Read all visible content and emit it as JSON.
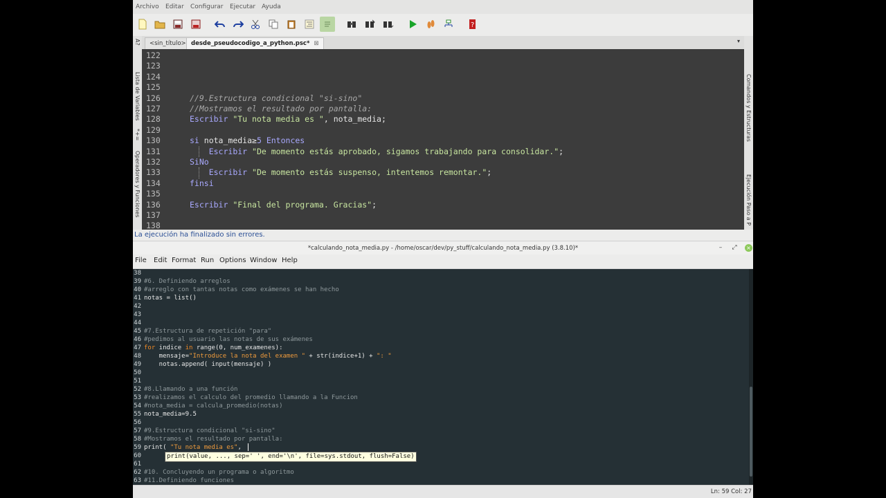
{
  "pseint": {
    "menu": [
      "Archivo",
      "Editar",
      "Configurar",
      "Ejecutar",
      "Ayuda"
    ],
    "left_panel_labels": [
      "Lista de Variables",
      "Operadores y Funciones"
    ],
    "left_panel_symbols": [
      "A?",
      "*+="
    ],
    "right_panel_labels": [
      "Comandos y Estructuras",
      "Ejecución Paso a P"
    ],
    "tabs": [
      {
        "label": "<sin_título>",
        "active": false
      },
      {
        "label": "desde_pseudocodigo_a_python.psc*",
        "active": true
      }
    ],
    "tab_close": "⊠",
    "tab_menu_arrow": "▾",
    "code_lines": [
      {
        "n": "122",
        "segs": []
      },
      {
        "n": "123",
        "segs": []
      },
      {
        "n": "124",
        "segs": []
      },
      {
        "n": "125",
        "segs": []
      },
      {
        "n": "126",
        "segs": [
          {
            "t": "//9.Estructura condicional \"si-sino\"",
            "c": "cmt"
          }
        ]
      },
      {
        "n": "127",
        "segs": [
          {
            "t": "//Mostramos el resultado por pantalla:",
            "c": "cmt"
          }
        ]
      },
      {
        "n": "128",
        "segs": [
          {
            "t": "Escribir ",
            "c": "kw"
          },
          {
            "t": "\"Tu nota media es \"",
            "c": "str"
          },
          {
            "t": ", nota_media;",
            "c": "txt"
          }
        ]
      },
      {
        "n": "129",
        "segs": []
      },
      {
        "n": "130",
        "segs": [
          {
            "t": "si ",
            "c": "kw"
          },
          {
            "t": "nota_media",
            "c": "txt"
          },
          {
            "t": "≥",
            "c": "txt"
          },
          {
            "t": "5",
            "c": "num"
          },
          {
            "t": " Entonces",
            "c": "kw"
          }
        ]
      },
      {
        "n": "131",
        "segs": [
          {
            "t": "    ",
            "c": "txt"
          },
          {
            "t": "Escribir ",
            "c": "kw"
          },
          {
            "t": "\"De momento estás aprobado, sigamos trabajando para consolidar.\"",
            "c": "str"
          },
          {
            "t": ";",
            "c": "txt"
          }
        ]
      },
      {
        "n": "132",
        "segs": [
          {
            "t": "SiNo",
            "c": "kw"
          }
        ]
      },
      {
        "n": "133",
        "segs": [
          {
            "t": "    ",
            "c": "txt"
          },
          {
            "t": "Escribir ",
            "c": "kw"
          },
          {
            "t": "\"De momento estás suspenso, intentemos remontar.\"",
            "c": "str"
          },
          {
            "t": ";",
            "c": "txt"
          }
        ]
      },
      {
        "n": "134",
        "segs": [
          {
            "t": "finsi",
            "c": "kw"
          }
        ]
      },
      {
        "n": "135",
        "segs": []
      },
      {
        "n": "136",
        "segs": [
          {
            "t": "Escribir ",
            "c": "kw"
          },
          {
            "t": "\"Final del programa. Gracias\"",
            "c": "str"
          },
          {
            "t": ";",
            "c": "txt"
          }
        ]
      },
      {
        "n": "137",
        "segs": []
      },
      {
        "n": "138",
        "segs": []
      }
    ],
    "status_message": "La ejecución ha finalizado sin errores."
  },
  "idle": {
    "title": "*calculando_nota_media.py - /home/oscar/dev/py_stuff/calculando_nota_media.py (3.8.10)*",
    "window_buttons": {
      "minimize": "–",
      "maximize": "⤢",
      "close": "×"
    },
    "menu": [
      "File",
      "Edit",
      "Format",
      "Run",
      "Options",
      "Window",
      "Help"
    ],
    "code_lines": [
      {
        "n": "38",
        "segs": []
      },
      {
        "n": "39",
        "segs": [
          {
            "t": "#6. Definiendo arreglos",
            "c": "icmt"
          }
        ]
      },
      {
        "n": "40",
        "segs": [
          {
            "t": "#arreglo con tantas notas como exámenes se han hecho",
            "c": "icmt"
          }
        ]
      },
      {
        "n": "41",
        "segs": [
          {
            "t": "notas = list()",
            "c": "idef"
          }
        ]
      },
      {
        "n": "42",
        "segs": []
      },
      {
        "n": "43",
        "segs": []
      },
      {
        "n": "44",
        "segs": []
      },
      {
        "n": "45",
        "segs": [
          {
            "t": "#7.Estructura de repetición \"para\"",
            "c": "icmt"
          }
        ]
      },
      {
        "n": "46",
        "segs": [
          {
            "t": "#pedimos al usuario las notas de sus exámenes",
            "c": "icmt"
          }
        ]
      },
      {
        "n": "47",
        "segs": [
          {
            "t": "for",
            "c": "ikw"
          },
          {
            "t": " indice ",
            "c": "idef"
          },
          {
            "t": "in",
            "c": "ikw"
          },
          {
            "t": " range(0, num_examenes):",
            "c": "idef"
          }
        ]
      },
      {
        "n": "48",
        "segs": [
          {
            "t": "    mensaje=",
            "c": "idef"
          },
          {
            "t": "\"Introduce la nota del examen \"",
            "c": "istr"
          },
          {
            "t": " + str(indice+1) + ",
            "c": "idef"
          },
          {
            "t": "\": \"",
            "c": "istr"
          }
        ]
      },
      {
        "n": "49",
        "segs": [
          {
            "t": "    notas.append( input(mensaje) )",
            "c": "idef"
          }
        ]
      },
      {
        "n": "50",
        "segs": []
      },
      {
        "n": "51",
        "segs": []
      },
      {
        "n": "52",
        "segs": [
          {
            "t": "#8.Llamando a una función",
            "c": "icmt"
          }
        ]
      },
      {
        "n": "53",
        "segs": [
          {
            "t": "#realizamos el calculo del promedio llamando a la Funcion",
            "c": "icmt"
          }
        ]
      },
      {
        "n": "54",
        "segs": [
          {
            "t": "#nota_media = calcula_promedio(notas)",
            "c": "icmt"
          }
        ]
      },
      {
        "n": "55",
        "segs": [
          {
            "t": "nota_media=9.5",
            "c": "idef"
          }
        ]
      },
      {
        "n": "56",
        "segs": []
      },
      {
        "n": "57",
        "segs": [
          {
            "t": "#9.Estructura condicional \"si-sino\"",
            "c": "icmt"
          }
        ]
      },
      {
        "n": "58",
        "segs": [
          {
            "t": "#Mostramos el resultado por pantalla:",
            "c": "icmt"
          }
        ]
      },
      {
        "n": "59",
        "segs": [
          {
            "t": "print( ",
            "c": "idef"
          },
          {
            "t": "\"Tu nota media es\"",
            "c": "istr"
          },
          {
            "t": ", ",
            "c": "idef"
          }
        ]
      },
      {
        "n": "60",
        "segs": []
      },
      {
        "n": "61",
        "segs": []
      },
      {
        "n": "62",
        "segs": [
          {
            "t": "#10. Concluyendo un programa o algoritmo",
            "c": "icmt"
          }
        ]
      },
      {
        "n": "63",
        "segs": [
          {
            "t": "#11.Definiendo funciones",
            "c": "icmt"
          }
        ]
      }
    ],
    "calltip": "print(value, ..., sep=' ', end='\\n', file=sys.stdout, flush=False)",
    "status": "Ln: 59  Col: 27"
  }
}
